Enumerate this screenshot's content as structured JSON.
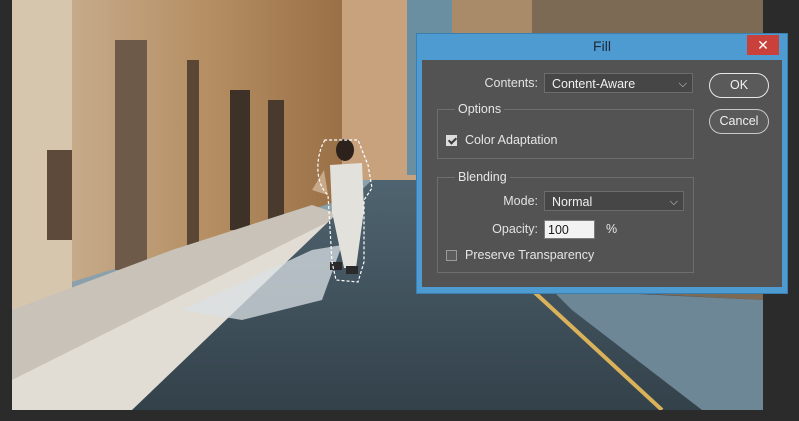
{
  "dialog": {
    "title": "Fill",
    "close_glyph": "✕",
    "contents_label": "Contents:",
    "contents_value": "Content-Aware",
    "options_title": "Options",
    "color_adaptation_label": "Color Adaptation",
    "color_adaptation_checked": true,
    "blending_title": "Blending",
    "mode_label": "Mode:",
    "mode_value": "Normal",
    "opacity_label": "Opacity:",
    "opacity_value": "100",
    "opacity_unit": "%",
    "preserve_transparency_label": "Preserve Transparency",
    "preserve_transparency_checked": false,
    "ok_label": "OK",
    "cancel_label": "Cancel",
    "chevron_glyph": "⌵"
  },
  "colors": {
    "title_bar": "#4e9bd1",
    "close_button": "#c9413a",
    "panel": "#535353",
    "workspace": "#2b2b2b"
  }
}
